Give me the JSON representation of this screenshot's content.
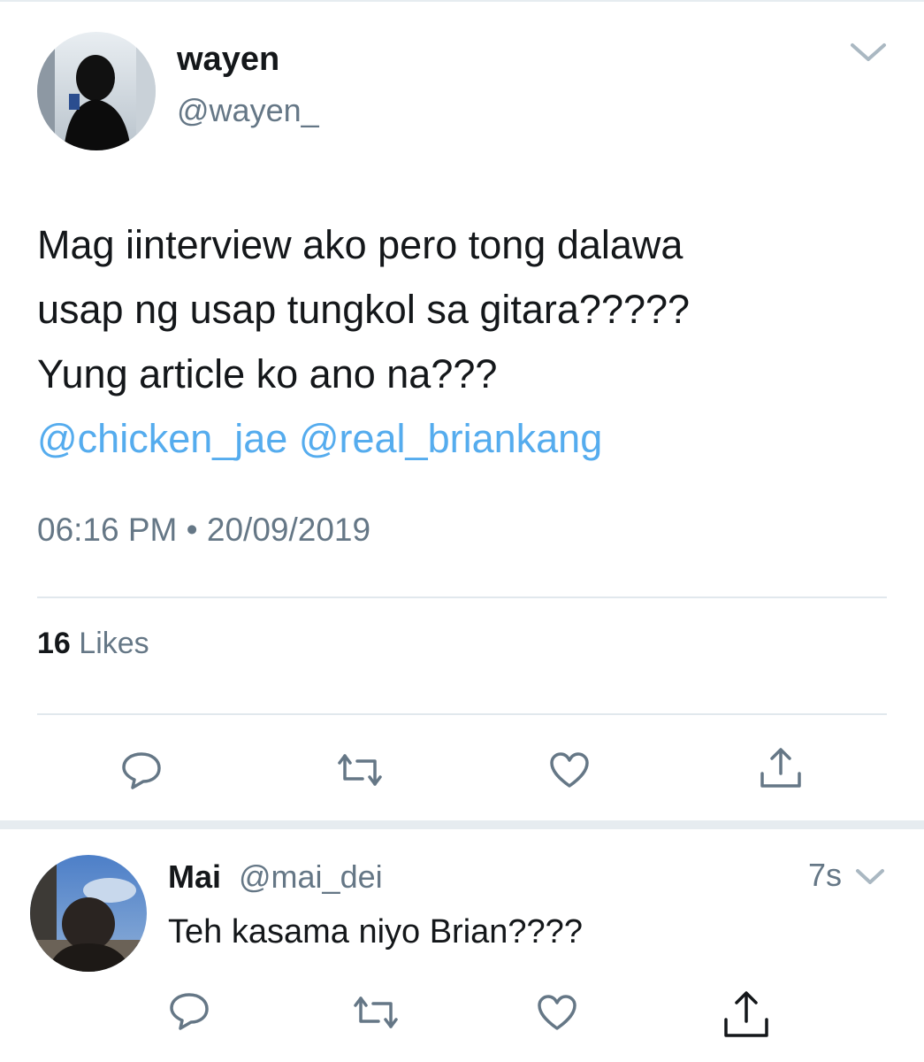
{
  "tweet": {
    "display_name": "wayen",
    "handle": "@wayen_",
    "text_lines": [
      "Mag iinterview ako pero tong dalawa",
      "usap ng usap tungkol sa gitara?????",
      "Yung article ko ano na???"
    ],
    "mentions": "@chicken_jae @real_briankang",
    "timestamp": "06:16 PM • 20/09/2019",
    "likes_count": "16",
    "likes_label": "Likes"
  },
  "reply": {
    "display_name": "Mai",
    "handle": "@mai_dei",
    "time": "7s",
    "text": "Teh kasama niyo Brian????"
  },
  "icons": {
    "menu": "chevron-down-icon",
    "actions": [
      "reply-icon",
      "retweet-icon",
      "like-icon",
      "share-icon"
    ]
  },
  "colors": {
    "mention": "#55acee",
    "secondary_text": "#657786",
    "divider": "#e1e8ed",
    "icon": "#657786"
  }
}
